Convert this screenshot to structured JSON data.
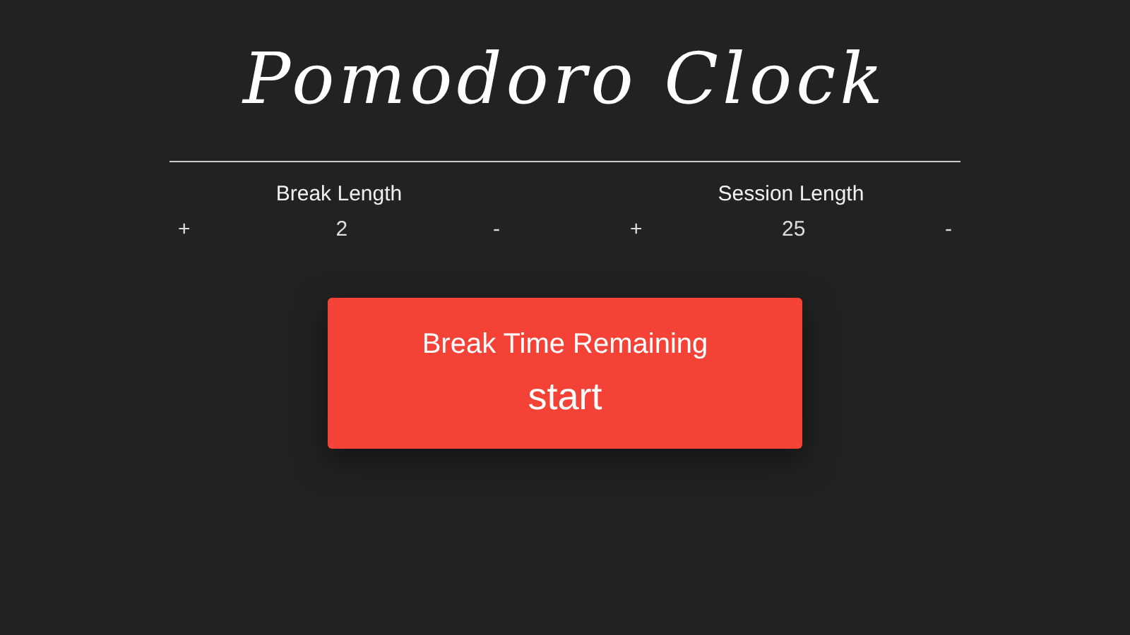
{
  "title": "Pomodoro Clock",
  "settings": [
    {
      "label": "Break Length",
      "increment": "+",
      "value": "2",
      "decrement": "-"
    },
    {
      "label": "Session Length",
      "increment": "+",
      "value": "25",
      "decrement": "-"
    }
  ],
  "timer": {
    "label": "Break Time Remaining",
    "display": "start"
  }
}
